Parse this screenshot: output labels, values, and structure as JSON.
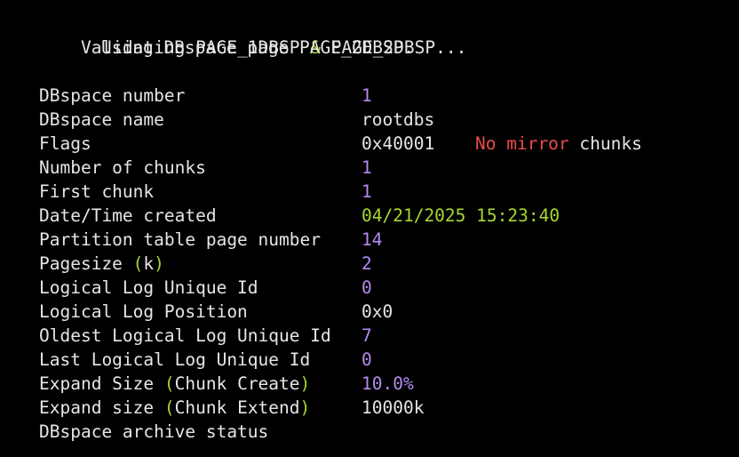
{
  "header": {
    "validating_prefix": "Validating PAGE_1DBSP ",
    "amp": "&",
    "validating_suffix": " PAGE_2DBSP...",
    "using_line": "Using DBspace page PAGE_2DBSP."
  },
  "colors": {
    "background": "#000000",
    "text": "#e6e6e6",
    "number": "#b48cf2",
    "date_and_parens": "#a6d82e",
    "warning": "#ec4b4b"
  },
  "rows": {
    "dbspace_number": {
      "label": "DBspace number",
      "value": "1"
    },
    "dbspace_name": {
      "label": "DBspace name",
      "value": "rootdbs"
    },
    "flags": {
      "label": "Flags",
      "value": "0x40001",
      "note_warning": "No mirror",
      "note_suffix": " chunks"
    },
    "number_of_chunks": {
      "label": "Number of chunks",
      "value": "1"
    },
    "first_chunk": {
      "label": "First chunk",
      "value": "1"
    },
    "date_time_created": {
      "label": "Date/Time created",
      "value": "04/21/2025 15:23:40"
    },
    "partition_table_page": {
      "label": "Partition table page number",
      "value": "14"
    },
    "pagesize": {
      "label_pre": "Pagesize ",
      "paren_open": "(",
      "label_inner": "k",
      "paren_close": ")",
      "value": "2"
    },
    "logical_log_unique_id": {
      "label": "Logical Log Unique Id",
      "value": "0"
    },
    "logical_log_position": {
      "label": "Logical Log Position",
      "value": "0x0"
    },
    "oldest_logical_log_unique_id": {
      "label": "Oldest Logical Log Unique Id",
      "value": "7"
    },
    "last_logical_log_unique_id": {
      "label": "Last Logical Log Unique Id",
      "value": "0"
    },
    "expand_size_create": {
      "label_pre": "Expand Size ",
      "paren_open": "(",
      "label_inner": "Chunk Create",
      "paren_close": ")",
      "value": "10.0%"
    },
    "expand_size_extend": {
      "label_pre": "Expand size ",
      "paren_open": "(",
      "label_inner": "Chunk Extend",
      "paren_close": ")",
      "value": "10000k"
    },
    "archive_status": {
      "label": "DBspace archive status"
    }
  }
}
